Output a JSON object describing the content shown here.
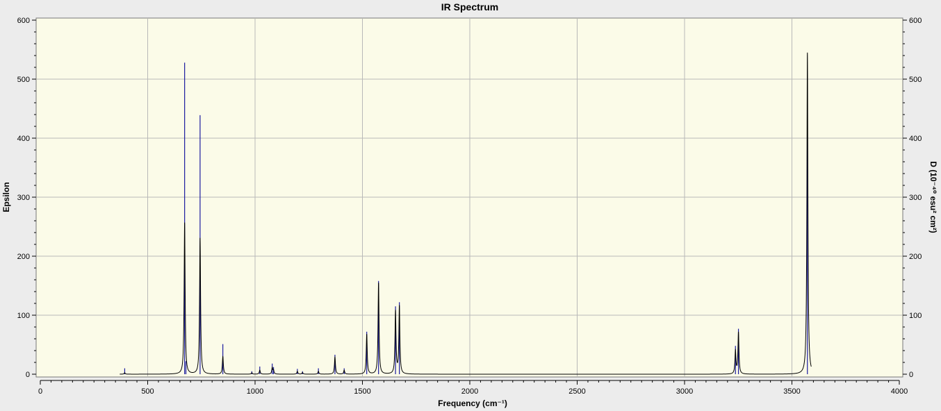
{
  "chart_data": {
    "type": "line",
    "title": "IR Spectrum",
    "xlabel": "Frequency (cm⁻¹)",
    "ylabel": "Epsilon",
    "y2label": "D (10⁻⁴⁰ esu² cm²)",
    "xlim": [
      0,
      4000
    ],
    "ylim": [
      0,
      600
    ],
    "y2lim": [
      0,
      600
    ],
    "x_ticks": [
      0,
      500,
      1000,
      1500,
      2000,
      2500,
      3000,
      3500,
      4000
    ],
    "y_ticks": [
      0,
      100,
      200,
      300,
      400,
      500,
      600
    ],
    "y2_ticks": [
      0,
      100,
      200,
      300,
      400,
      500,
      600
    ],
    "grid": true,
    "colors": {
      "plot_background": "#fbfbe8",
      "grid": "#b8b8b8",
      "spectrum_line": "#000000",
      "stick_line": "#1a1a9e"
    },
    "spectrum_range": [
      370,
      3590
    ],
    "series": [
      {
        "role": "spectrum",
        "peaks": [
          {
            "x": 393,
            "y": 2.5
          },
          {
            "x": 672,
            "y": 257
          },
          {
            "x": 678,
            "y": 15
          },
          {
            "x": 744,
            "y": 231
          },
          {
            "x": 850,
            "y": 30
          },
          {
            "x": 985,
            "y": 2.5
          },
          {
            "x": 1022,
            "y": 7
          },
          {
            "x": 1080,
            "y": 12
          },
          {
            "x": 1086,
            "y": 8
          },
          {
            "x": 1197,
            "y": 5
          },
          {
            "x": 1221,
            "y": 3
          },
          {
            "x": 1295,
            "y": 5
          },
          {
            "x": 1372,
            "y": 29
          },
          {
            "x": 1415,
            "y": 7
          },
          {
            "x": 1520,
            "y": 68
          },
          {
            "x": 1575,
            "y": 155
          },
          {
            "x": 1654,
            "y": 109
          },
          {
            "x": 1672,
            "y": 117
          },
          {
            "x": 3237,
            "y": 42
          },
          {
            "x": 3251,
            "y": 72
          },
          {
            "x": 3572,
            "y": 545
          }
        ]
      },
      {
        "role": "sticks",
        "x": [
          393,
          672,
          678,
          744,
          850,
          985,
          1022,
          1080,
          1086,
          1197,
          1221,
          1295,
          1372,
          1415,
          1520,
          1575,
          1654,
          1672,
          3237,
          3251,
          3572
        ],
        "y": [
          10,
          528,
          22,
          439,
          51,
          5,
          13,
          18,
          12,
          9,
          5,
          10,
          33,
          10,
          72,
          158,
          115,
          122,
          48,
          77,
          448
        ]
      }
    ]
  }
}
